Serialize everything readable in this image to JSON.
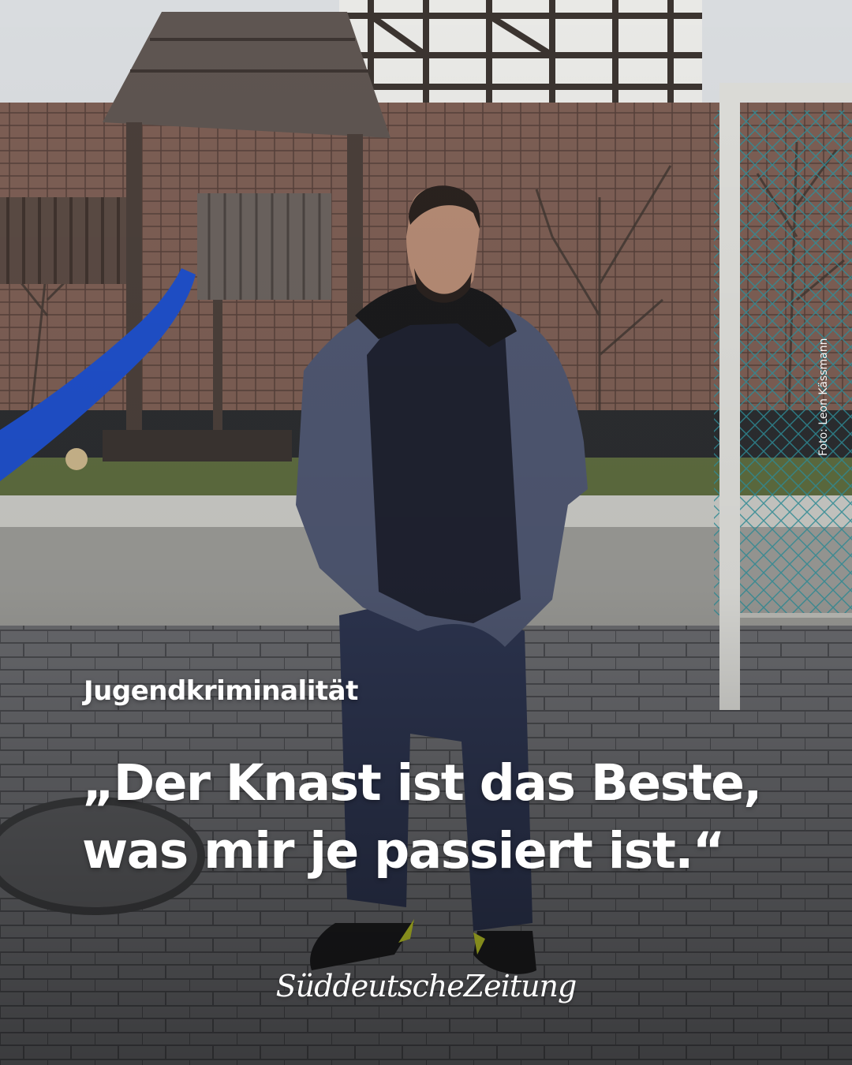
{
  "post": {
    "kicker": "Jugendkriminalität",
    "headline_line1": "„Der Knast ist das Beste,",
    "headline_line2": "was mir je passiert ist.“",
    "photo_credit": "Foto: Leon Kässmann",
    "brand_logo": "SüddeutscheZeitung"
  },
  "colors": {
    "text": "#ffffff",
    "sky": "#dcdfe2",
    "roof": "#8a6a5e",
    "pavement": "#6e6f73",
    "slide": "#1f4fc8",
    "jacket": "#4e5670",
    "jeans": "#2d3550",
    "net": "#2f8f9a"
  }
}
